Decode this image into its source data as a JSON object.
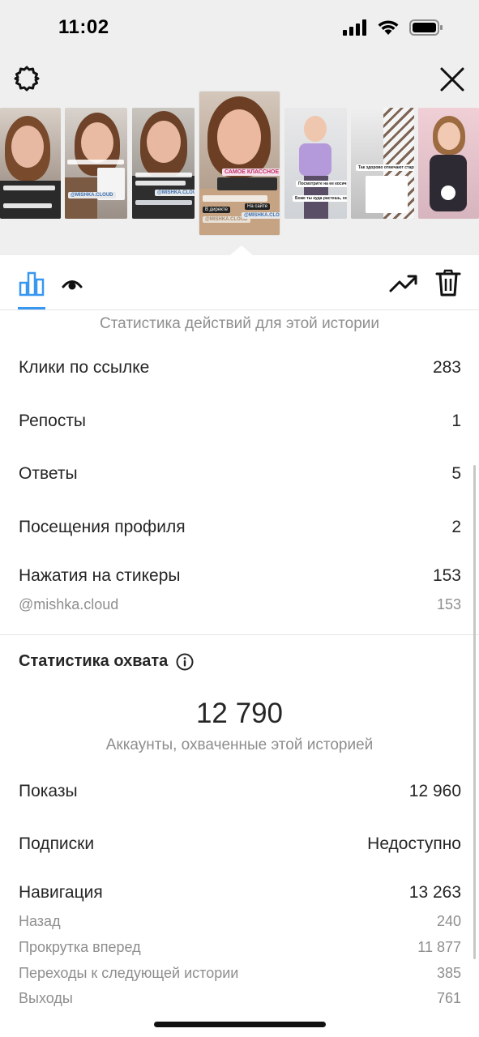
{
  "status_bar": {
    "time": "11:02"
  },
  "story_stickers": {
    "link_tag_1": "@MISHKA.CLOUD",
    "link_tag_2": "@MISHKA.CLOUD",
    "active_caption": "САМОЕ КЛАССНОЕ",
    "active_dm": "В директе",
    "active_site": "На сайте",
    "active_tag": "@MISHKA.CLOUD",
    "kid_caption": "Посмотрите на ее косички",
    "kid_caption_2": "Боже ты куда растешь, остановись",
    "stairs_caption": "Так здорово отмечают старый Новый Год"
  },
  "tabs": {
    "stats_active": true
  },
  "actions_section": {
    "caption": "Статистика действий для этой истории",
    "rows": [
      {
        "label": "Клики по ссылке",
        "value": "283"
      },
      {
        "label": "Репосты",
        "value": "1"
      },
      {
        "label": "Ответы",
        "value": "5"
      },
      {
        "label": "Посещения профиля",
        "value": "2"
      },
      {
        "label": "Нажатия на стикеры",
        "value": "153"
      }
    ],
    "sticker_sub": {
      "label": "@mishka.cloud",
      "value": "153"
    }
  },
  "reach_section": {
    "title": "Статистика охвата",
    "accounts_reached": "12 790",
    "accounts_caption": "Аккаунты, охваченные этой историей",
    "rows": [
      {
        "label": "Показы",
        "value": "12 960"
      },
      {
        "label": "Подписки",
        "value": "Недоступно"
      },
      {
        "label": "Навигация",
        "value": "13 263"
      }
    ],
    "navigation_sub": [
      {
        "label": "Назад",
        "value": "240"
      },
      {
        "label": "Прокрутка вперед",
        "value": "11 877"
      },
      {
        "label": "Переходы к следующей истории",
        "value": "385"
      },
      {
        "label": "Выходы",
        "value": "761"
      }
    ]
  },
  "colors": {
    "accent": "#3897f0",
    "text": "#262626",
    "secondary": "#8e8e8e",
    "top_bg": "#efefef"
  },
  "icons": [
    "gear-icon",
    "close-icon",
    "bar-chart-icon",
    "eye-icon",
    "trend-up-icon",
    "trash-icon",
    "info-icon"
  ]
}
